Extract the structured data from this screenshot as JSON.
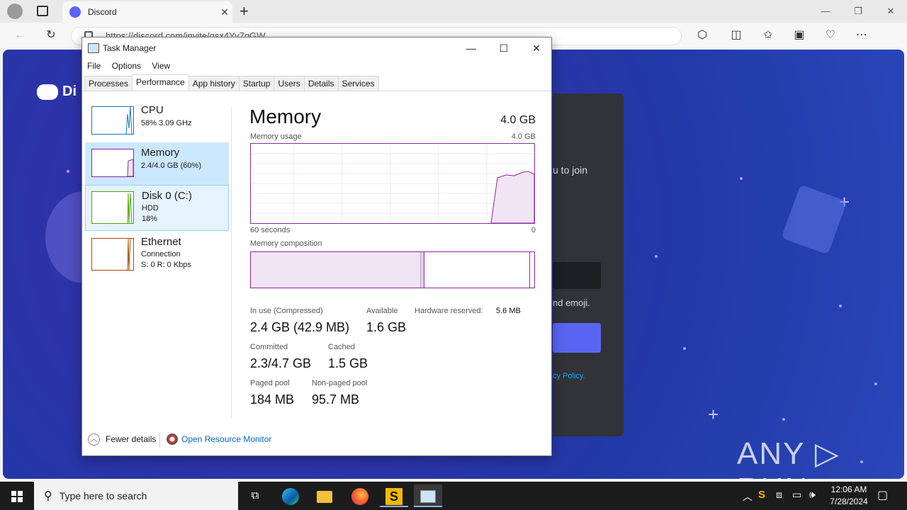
{
  "browser": {
    "tab_title": "Discord",
    "tab_close": "✕",
    "new_tab": "+",
    "url": "https://discord.com/invite/gsx4Yv7qGW",
    "min": "—",
    "max": "❐",
    "close": "✕"
  },
  "discord": {
    "logo_text": "Di",
    "text_join": "u to join",
    "text_emoji": "nd emoji.",
    "text_policy": "cy Policy."
  },
  "watermark": "ANY ▷ RUN",
  "task_manager": {
    "title": "Task Manager",
    "menu": [
      "File",
      "Options",
      "View"
    ],
    "tabs": [
      "Processes",
      "Performance",
      "App history",
      "Startup",
      "Users",
      "Details",
      "Services"
    ],
    "active_tab": "Performance",
    "sidebar": {
      "cpu": {
        "name": "CPU",
        "sub1": "58%  3.09 GHz"
      },
      "memory": {
        "name": "Memory",
        "sub1": "2.4/4.0 GB (60%)"
      },
      "disk": {
        "name": "Disk 0 (C:)",
        "sub1": "HDD",
        "sub2": "18%"
      },
      "ethernet": {
        "name": "Ethernet",
        "sub1": "Connection",
        "sub2": "S: 0 R: 0 Kbps"
      }
    },
    "memory": {
      "title": "Memory",
      "total": "4.0 GB",
      "usage_label": "Memory usage",
      "usage_max": "4.0 GB",
      "axis_left": "60 seconds",
      "axis_right": "0",
      "composition_label": "Memory composition",
      "in_use_label": "In use (Compressed)",
      "in_use_value": "2.4 GB (42.9 MB)",
      "available_label": "Available",
      "available_value": "1.6 GB",
      "hw_reserved_label": "Hardware reserved:",
      "hw_reserved_value": "5.6 MB",
      "committed_label": "Committed",
      "committed_value": "2.3/4.7 GB",
      "cached_label": "Cached",
      "cached_value": "1.5 GB",
      "paged_label": "Paged pool",
      "paged_value": "184 MB",
      "nonpaged_label": "Non-paged pool",
      "nonpaged_value": "95.7 MB"
    },
    "footer": {
      "fewer_details": "Fewer details",
      "resource_monitor": "Open Resource Monitor"
    },
    "colors": {
      "memory": "#8b2aa1",
      "cpu": "#1779ba",
      "disk": "#4da60c",
      "ethernet": "#a74f01"
    }
  },
  "taskbar": {
    "search_placeholder": "Type here to search",
    "time": "12:06 AM",
    "date": "7/28/2024"
  }
}
